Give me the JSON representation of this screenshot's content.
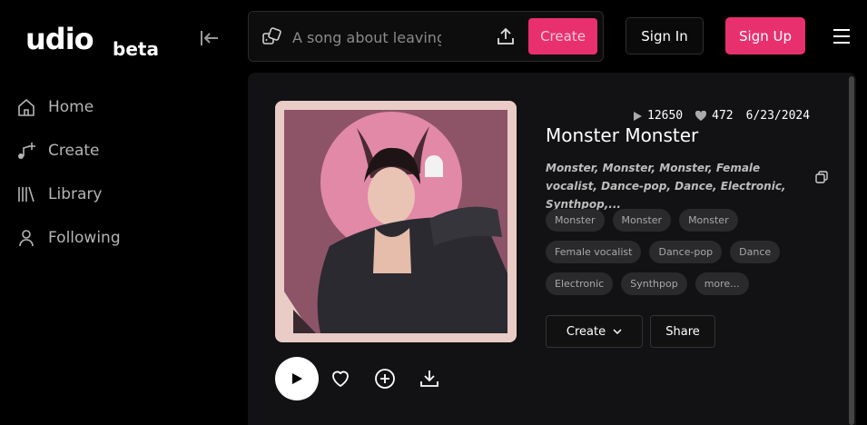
{
  "logo": {
    "main": "udio",
    "beta": "beta"
  },
  "search": {
    "placeholder": "A song about leaving",
    "create_label": "Create"
  },
  "auth": {
    "signin_label": "Sign In",
    "signup_label": "Sign Up"
  },
  "sidebar": {
    "items": [
      {
        "label": "Home",
        "icon": "home-icon"
      },
      {
        "label": "Create",
        "icon": "music-plus-icon"
      },
      {
        "label": "Library",
        "icon": "library-icon"
      },
      {
        "label": "Following",
        "icon": "user-icon"
      }
    ]
  },
  "song": {
    "plays": "12650",
    "likes": "472",
    "date": "6/23/2024",
    "title": "Monster Monster",
    "description": "Monster, Monster, Monster, Female vocalist, Dance-pop, Dance, Electronic, Synthpop,...",
    "tags": [
      [
        "Monster",
        "Monster",
        "Monster"
      ],
      [
        "Female vocalist",
        "Dance-pop",
        "Dance"
      ],
      [
        "Electronic",
        "Synthpop",
        "more..."
      ]
    ],
    "create_label": "Create",
    "share_label": "Share"
  },
  "colors": {
    "accent": "#e8306f",
    "panel": "#121214",
    "background": "#000000"
  }
}
